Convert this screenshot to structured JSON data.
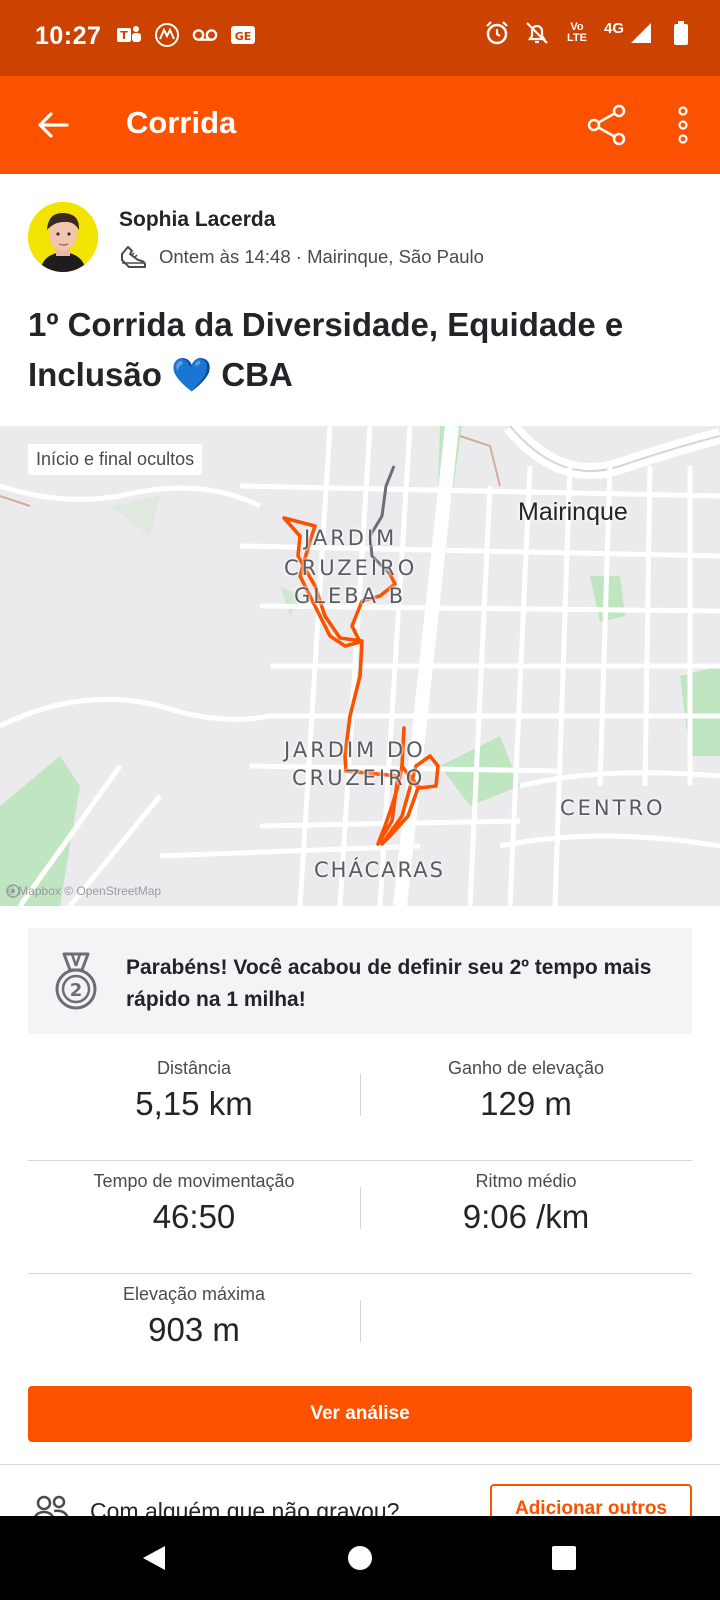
{
  "status_bar": {
    "time": "10:27",
    "network": "4G",
    "volte": "Vo LTE",
    "icons_left": [
      "teams-icon",
      "motorola-icon",
      "voicemail-icon",
      "ge-icon"
    ],
    "icons_right": [
      "alarm-icon",
      "bell-off-icon",
      "volte-icon",
      "signal-icon",
      "battery-icon"
    ]
  },
  "app_bar": {
    "title": "Corrida",
    "back_icon": "arrow-left-icon",
    "share_icon": "share-icon",
    "more_icon": "more-vertical-icon"
  },
  "athlete": {
    "name": "Sophia Lacerda",
    "meta": "Ontem às 14:48 · Mairinque, São Paulo",
    "activity_icon": "shoe-icon"
  },
  "activity": {
    "title_text": "1º Corrida da Diversidade, Equidade e Inclusão",
    "title_emoji": "💙",
    "title_suffix": "CBA"
  },
  "map": {
    "badge": "Início e final ocultos",
    "city": "Mairinque",
    "labels": {
      "jardim_cruzeiro_gleba_b_1": "JARDIM",
      "jardim_cruzeiro_gleba_b_2": "CRUZEIRO",
      "jardim_cruzeiro_gleba_b_3": "GLEBA B",
      "jardim_cruzeiro_1": "JARDIM DO",
      "jardim_cruzeiro_2": "CRUZEIRO",
      "centro": "CENTRO",
      "chacaras": "CHÁCARAS"
    },
    "attribution": "© Mapbox © OpenStreetMap",
    "route_color": "#fc5200",
    "hidden_segment_color": "#6d6d78"
  },
  "achievement": {
    "text": "Parabéns! Você acabou de definir seu 2º tempo mais rápido na 1 milha!",
    "medal_rank": "2"
  },
  "stats": [
    {
      "label": "Distância",
      "value": "5,15 km"
    },
    {
      "label": "Ganho de elevação",
      "value": "129 m"
    },
    {
      "label": "Tempo de movimentação",
      "value": "46:50"
    },
    {
      "label": "Ritmo médio",
      "value": "9:06 /km"
    },
    {
      "label": "Elevação máxima",
      "value": "903 m"
    }
  ],
  "buttons": {
    "analysis": "Ver análise",
    "add_others": "Adicionar outros"
  },
  "companion": {
    "text": "Com alguém que não gravou?"
  },
  "colors": {
    "brand": "#fc5200",
    "status_bar": "#cc4200"
  }
}
